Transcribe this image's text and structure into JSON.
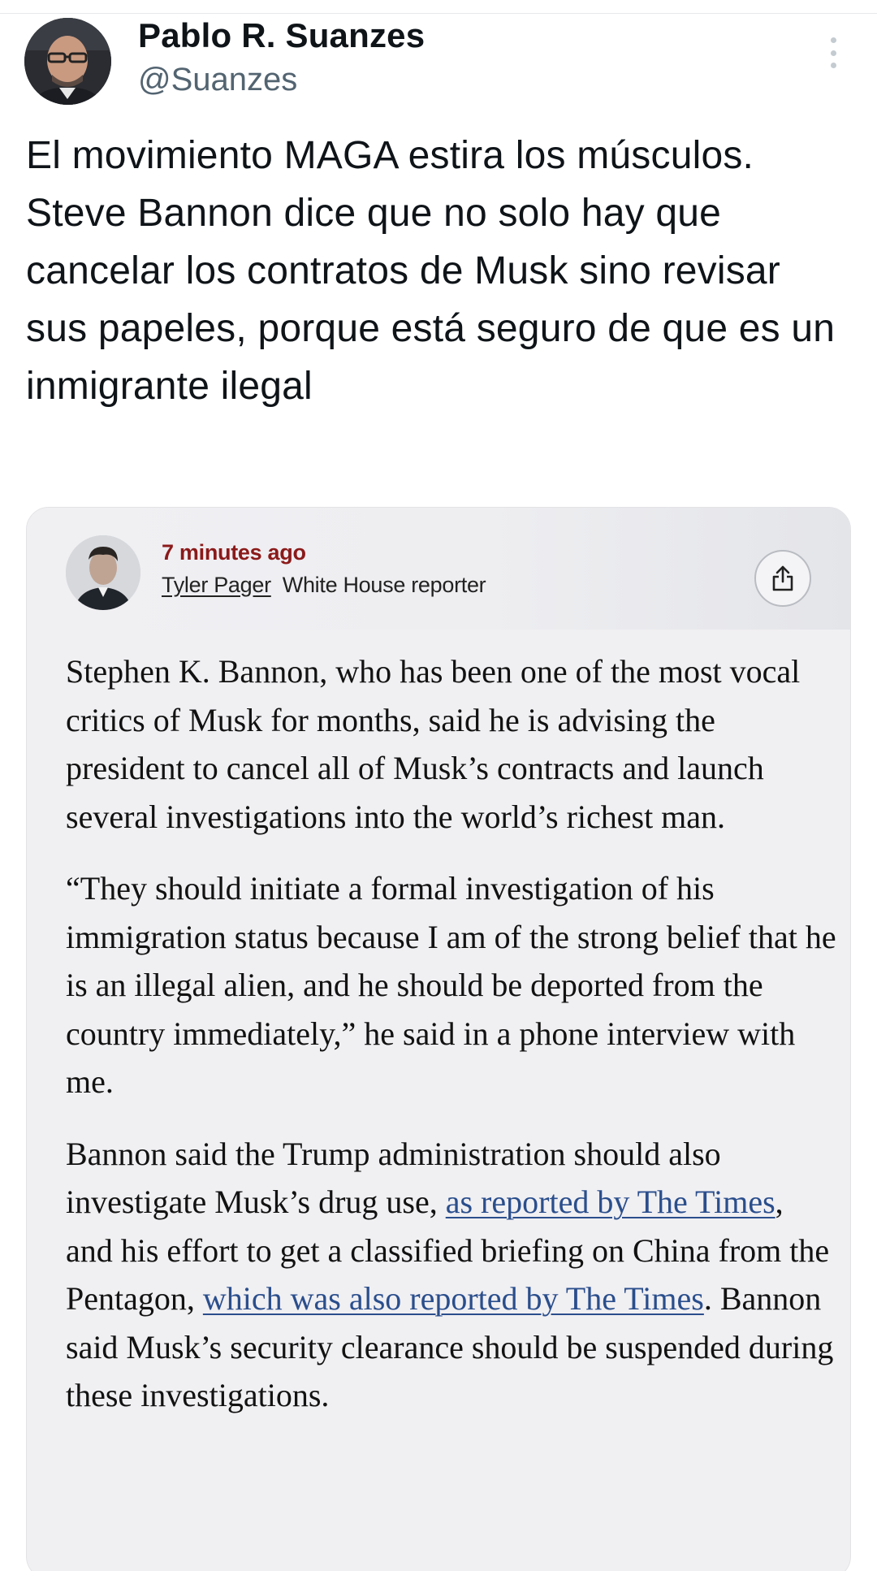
{
  "tweet": {
    "author_name": "Pablo R. Suanzes",
    "author_handle": "@Suanzes",
    "text": "El movimiento MAGA estira los músculos. Steve Bannon dice que no solo hay que cancelar los contratos de Musk sino revisar sus papeles, porque está seguro de que es un inmigrante ilegal"
  },
  "embedded_post": {
    "timestamp": "7 minutes ago",
    "reporter_name": "Tyler Pager",
    "reporter_role": "White House reporter",
    "paragraph1": "Stephen K. Bannon, who has been one of the most vocal critics of Musk for months, said he is advising the president to cancel all of Musk’s contracts and launch several investigations into the world’s richest man.",
    "paragraph2": "“They should initiate a formal investigation of his immigration status because I am of the strong belief that he is an illegal alien, and he should be deported from the country immediately,” he said in a phone interview with me.",
    "paragraph3": {
      "part1": "Bannon said the Trump administration should also investigate Musk’s drug use, ",
      "link1": "as reported by The Times",
      "part2": ", and his effort to get a classified briefing on China from the Pentagon, ",
      "link2": "which was also reported by The Times",
      "part3": ". Bannon said Musk’s security clearance should be suspended during these investigations."
    }
  },
  "icons": {
    "more": "more-vertical-icon",
    "share": "share-icon"
  },
  "colors": {
    "timestamp": "#8b1a1a",
    "link": "#2a4e8c",
    "handle": "#536471"
  }
}
